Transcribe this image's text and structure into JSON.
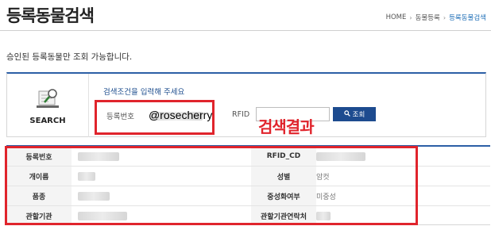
{
  "header": {
    "page_title": "등록동물검색",
    "breadcrumb": [
      "HOME",
      "동물등록",
      "등록동물검색"
    ]
  },
  "notice": "승인된 등록동물만 조회 가능합니다.",
  "search": {
    "side_label": "SEARCH",
    "hint": "검색조건을 입력해 주세요",
    "reg_no_label": "등록번호",
    "rfid_label": "RFID",
    "rfid_value": "",
    "button_label": "조회"
  },
  "overlay": {
    "watermark": "@rosecherry",
    "result_label": "검색결과",
    "highlight_color": "#e0242c"
  },
  "result": {
    "rows": [
      {
        "label1": "등록번호",
        "value1": "",
        "label2": "RFID_CD",
        "value2": ""
      },
      {
        "label1": "개이름",
        "value1": "",
        "label2": "성별",
        "value2": "암컷"
      },
      {
        "label1": "품종",
        "value1": "",
        "label2": "중성화여부",
        "value2": "미중성"
      },
      {
        "label1": "관할기관",
        "value1": "",
        "label2": "관할기관연락처",
        "value2": ""
      }
    ]
  },
  "icons": {
    "search_side": "magnifier-document-icon",
    "search_button": "search-icon"
  },
  "colors": {
    "accent": "#2c5fa6",
    "button": "#1d4b8f",
    "breadcrumb_current": "#1f6fb7"
  }
}
